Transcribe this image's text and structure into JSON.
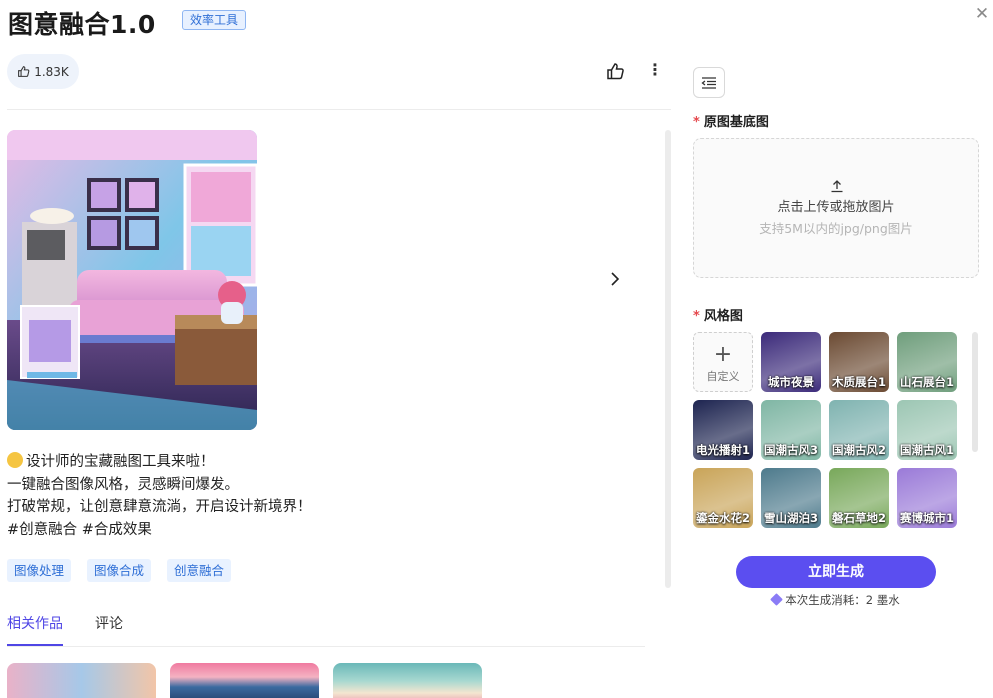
{
  "header": {
    "title": "图意融合1.0",
    "badge": "效率工具",
    "close_icon": "close-icon"
  },
  "stats": {
    "likes": "1.83K"
  },
  "description": {
    "lines": [
      "设计师的宝藏融图工具来啦！",
      "一键融合图像风格，灵感瞬间爆发。",
      "打破常规，让创意肆意流淌，开启设计新境界！",
      "#创意融合 #合成效果"
    ]
  },
  "tags": [
    "图像处理",
    "图像合成",
    "创意融合"
  ],
  "tabs": {
    "related": "相关作品",
    "comments": "评论"
  },
  "form": {
    "base_label": "原图基底图",
    "upload_main": "点击上传或拖放图片",
    "upload_sub": "支持5M以内的jpg/png图片",
    "style_label": "风格图",
    "custom_label": "自定义",
    "styles": [
      {
        "label": "城市夜景",
        "color": "#3b2a7a"
      },
      {
        "label": "木质展台1",
        "color": "#6b4a32"
      },
      {
        "label": "山石展台1",
        "color": "#6f9e7c"
      },
      {
        "label": "电光播射1",
        "color": "#1d2450"
      },
      {
        "label": "国潮古风3",
        "color": "#7fb6a4"
      },
      {
        "label": "国潮古风2",
        "color": "#7fb3b0"
      },
      {
        "label": "国潮古风1",
        "color": "#9cc6b3"
      },
      {
        "label": "鎏金水花2",
        "color": "#c9a458"
      },
      {
        "label": "雪山湖泊3",
        "color": "#4d7a8c"
      },
      {
        "label": "磐石草地2",
        "color": "#78a85a"
      },
      {
        "label": "赛博城市1",
        "color": "#9a7ad8"
      }
    ],
    "generate_button": "立即生成",
    "cost_text": "本次生成消耗：2 墨水"
  }
}
